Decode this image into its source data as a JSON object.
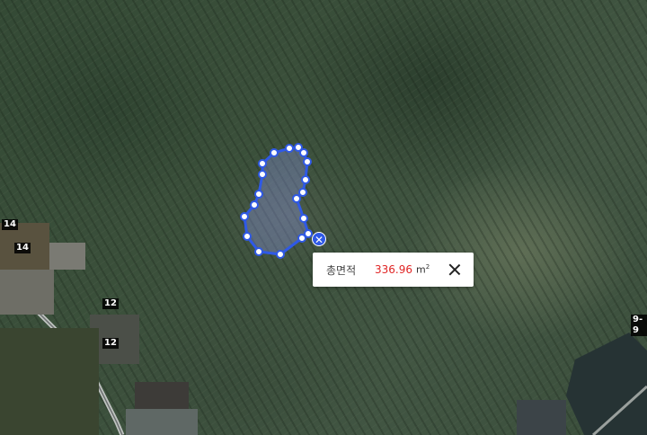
{
  "map": {
    "parcel_labels": [
      "14",
      "14",
      "12",
      "12",
      "9-9"
    ],
    "area_popup": {
      "label": "총면적",
      "value": "336.96",
      "unit": "m",
      "unit_exp": "2"
    },
    "colors": {
      "polygon_stroke": "#2f59e6",
      "polygon_fill": "rgba(140,150,230,0.35)",
      "vertex_fill": "#ffffff",
      "area_value": "#e02525"
    },
    "icons": [
      "close-icon",
      "remove-measure-icon"
    ]
  }
}
